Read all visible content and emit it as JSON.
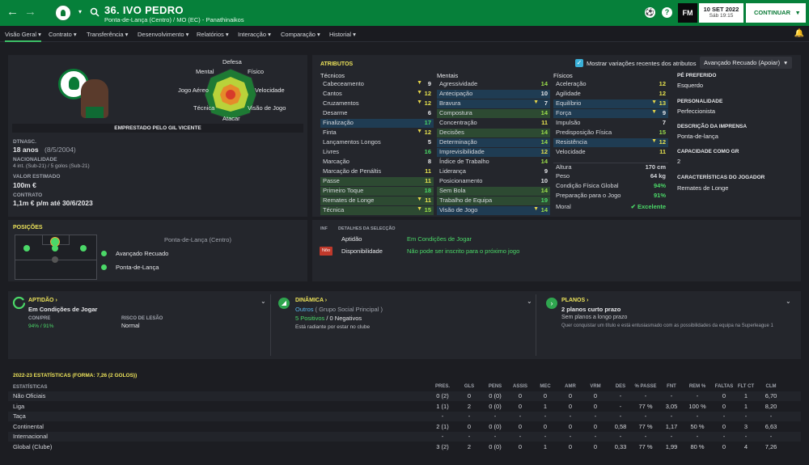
{
  "header": {
    "back_icon": "←",
    "forward_icon": "→",
    "player_title": "36. IVO PEDRO",
    "player_subtitle": "Ponta-de-Lança (Centro) / MO (EC) - Panathinaikos",
    "fm_label": "FM",
    "date": "10 SET 2022",
    "day_time": "Sáb 19:15",
    "continue_label": "CONTINUAR"
  },
  "tabs": [
    "Visão Geral",
    "Contrato",
    "Transferência",
    "Desenvolvimento",
    "Relatórios",
    "Interacção",
    "Comparação",
    "Historial"
  ],
  "profile": {
    "loan_text": "EMPRESTADO PELO GIL VICENTE",
    "dob_label": "DTNASC.",
    "age": "18 anos",
    "dob": "(8/5/2004)",
    "nationality_label": "NACIONALIDADE",
    "nationality_value": "4 int. (Sub-21) / 5 golos (Sub-21)",
    "value_label": "VALOR ESTIMADO",
    "value": "100m €",
    "contract_label": "CONTRATO",
    "contract": "1,1m € p/m até 30/6/2023"
  },
  "radar": {
    "labels": [
      "Defesa",
      "Físico",
      "Velocidade",
      "Visão de Jogo",
      "Atacar",
      "Técnica",
      "Jogo Aéreo",
      "Mental"
    ]
  },
  "attributes": {
    "title": "ATRIBUTOS",
    "show_changes_label": "Mostrar variações recentes dos atributos",
    "role_select": "Avançado Recuado (Apoiar)",
    "tech_header": "Técnicos",
    "mental_header": "Mentais",
    "phys_header": "Físicos",
    "technical": [
      {
        "n": "Cabeceamento",
        "v": "9",
        "arr": "▼"
      },
      {
        "n": "Cantos",
        "v": "12",
        "arr": "▼"
      },
      {
        "n": "Cruzamentos",
        "v": "12",
        "arr": "▼"
      },
      {
        "n": "Desarme",
        "v": "6",
        "arr": ""
      },
      {
        "n": "Finalização",
        "v": "17",
        "arr": ""
      },
      {
        "n": "Finta",
        "v": "12",
        "arr": "▼"
      },
      {
        "n": "Lançamentos Longos",
        "v": "5",
        "arr": ""
      },
      {
        "n": "Livres",
        "v": "16",
        "arr": ""
      },
      {
        "n": "Marcação",
        "v": "8",
        "arr": ""
      },
      {
        "n": "Marcação de Penáltis",
        "v": "11",
        "arr": ""
      },
      {
        "n": "Passe",
        "v": "11",
        "arr": ""
      },
      {
        "n": "Primeiro Toque",
        "v": "18",
        "arr": ""
      },
      {
        "n": "Remates de Longe",
        "v": "11",
        "arr": "▼"
      },
      {
        "n": "Técnica",
        "v": "15",
        "arr": "▼"
      }
    ],
    "mental": [
      {
        "n": "Agressividade",
        "v": "14",
        "arr": ""
      },
      {
        "n": "Antecipação",
        "v": "10",
        "arr": ""
      },
      {
        "n": "Bravura",
        "v": "7",
        "arr": "▼"
      },
      {
        "n": "Compostura",
        "v": "14",
        "arr": ""
      },
      {
        "n": "Concentração",
        "v": "11",
        "arr": ""
      },
      {
        "n": "Decisões",
        "v": "14",
        "arr": ""
      },
      {
        "n": "Determinação",
        "v": "14",
        "arr": ""
      },
      {
        "n": "Imprevisibilidade",
        "v": "12",
        "arr": ""
      },
      {
        "n": "Índice de Trabalho",
        "v": "14",
        "arr": ""
      },
      {
        "n": "Liderança",
        "v": "9",
        "arr": ""
      },
      {
        "n": "Posicionamento",
        "v": "10",
        "arr": ""
      },
      {
        "n": "Sem Bola",
        "v": "14",
        "arr": ""
      },
      {
        "n": "Trabalho de Equipa",
        "v": "19",
        "arr": ""
      },
      {
        "n": "Visão de Jogo",
        "v": "14",
        "arr": "▼"
      }
    ],
    "physical": [
      {
        "n": "Aceleração",
        "v": "12",
        "arr": ""
      },
      {
        "n": "Agilidade",
        "v": "12",
        "arr": ""
      },
      {
        "n": "Equilíbrio",
        "v": "13",
        "arr": "▼"
      },
      {
        "n": "Força",
        "v": "9",
        "arr": "▼"
      },
      {
        "n": "Impulsão",
        "v": "7",
        "arr": ""
      },
      {
        "n": "Predisposição Física",
        "v": "15",
        "arr": ""
      },
      {
        "n": "Resistência",
        "v": "12",
        "arr": "▼"
      },
      {
        "n": "Velocidade",
        "v": "11",
        "arr": ""
      }
    ],
    "extra": [
      {
        "n": "Altura",
        "v": "170 cm"
      },
      {
        "n": "Peso",
        "v": "64 kg"
      },
      {
        "n": "Condição Física Global",
        "v": "94%"
      },
      {
        "n": "Preparação para o Jogo",
        "v": "91%"
      },
      {
        "n": "Moral",
        "v": "Excelente"
      }
    ]
  },
  "info": {
    "foot_label": "PÉ PREFERIDO",
    "foot": "Esquerdo",
    "personality_label": "PERSONALIDADE",
    "personality": "Perfeccionista",
    "press_label": "DESCRIÇÃO DA IMPRENSA",
    "press": "Ponta-de-lança",
    "gk_label": "CAPACIDADE COMO GR",
    "gk": "2",
    "traits_label": "CARACTERÍSTICAS DO JOGADOR",
    "traits": "Remates de Longe"
  },
  "positions": {
    "title": "POSIÇÕES",
    "main": "Ponta-de-Lança (Centro)",
    "list": [
      "Avançado Recuado",
      "Ponta-de-Lança"
    ]
  },
  "selection": {
    "inf_label": "INF",
    "details_label": "DETALHES DA SELECÇÃO",
    "aptitude_label": "Aptidão",
    "aptitude_value": "Em Condições de Jogar",
    "avail_badge": "Nõo",
    "avail_label": "Disponibilidade",
    "avail_value": "Não pode ser inscrito para o próximo jogo"
  },
  "cards": {
    "aptidao_title": "APTIDÃO",
    "aptidao_value": "Em Condições de Jogar",
    "conpre_label": "CON/PRE",
    "conpre_value": "94% / 91%",
    "injury_label": "RISCO DE LESÃO",
    "injury_value": "Normal",
    "dinamica_title": "DINÂMICA",
    "group_link": "Outros",
    "group_text": "( Grupo Social Principal )",
    "positives": "5 Positivos",
    "negatives": "/ 0 Negativos",
    "dinamica_desc": "Está radiante por estar no clube",
    "planos_title": "PLANOS",
    "planos_value": "2 planos curto prazo",
    "planos_line1": "Sem planos a longo prazo",
    "planos_line2": "Quer conquistar um título e está entusiasmado com as possibilidades da equipa na Superleague 1"
  },
  "stats": {
    "title": "2022-23 ESTATÍSTICAS (FORMA: 7,26 (2 GOLOS))",
    "first_col": "ESTATÍSTICAS",
    "cols": [
      "PRES.",
      "GLS",
      "PENS",
      "ASSIS",
      "MEC",
      "AMR",
      "VRM",
      "DES",
      "% PASSE",
      "FNT",
      "REM %",
      "FALTAS",
      "FLT CT",
      "CLM"
    ],
    "rows": [
      {
        "n": "Não Oficiais",
        "c": [
          "0 (2)",
          "0",
          "0 (0)",
          "0",
          "0",
          "0",
          "0",
          "-",
          "-",
          "-",
          "-",
          "0",
          "1",
          "6,70"
        ]
      },
      {
        "n": "Liga",
        "c": [
          "1 (1)",
          "2",
          "0 (0)",
          "0",
          "1",
          "0",
          "0",
          "-",
          "77 %",
          "3,05",
          "100 %",
          "0",
          "1",
          "8,20"
        ]
      },
      {
        "n": "Taça",
        "c": [
          "-",
          "-",
          "-",
          "-",
          "-",
          "-",
          "-",
          "-",
          "-",
          "-",
          "-",
          "-",
          "-",
          "-"
        ]
      },
      {
        "n": "Continental",
        "c": [
          "2 (1)",
          "0",
          "0 (0)",
          "0",
          "0",
          "0",
          "0",
          "0,58",
          "77 %",
          "1,17",
          "50 %",
          "0",
          "3",
          "6,63"
        ]
      },
      {
        "n": "Internacional",
        "c": [
          "-",
          "-",
          "-",
          "-",
          "-",
          "-",
          "-",
          "-",
          "-",
          "-",
          "-",
          "-",
          "-",
          "-"
        ]
      },
      {
        "n": "Global (Clube)",
        "c": [
          "3 (2)",
          "2",
          "0 (0)",
          "0",
          "1",
          "0",
          "0",
          "0,33",
          "77 %",
          "1,99",
          "80 %",
          "0",
          "4",
          "7,26"
        ]
      }
    ]
  }
}
